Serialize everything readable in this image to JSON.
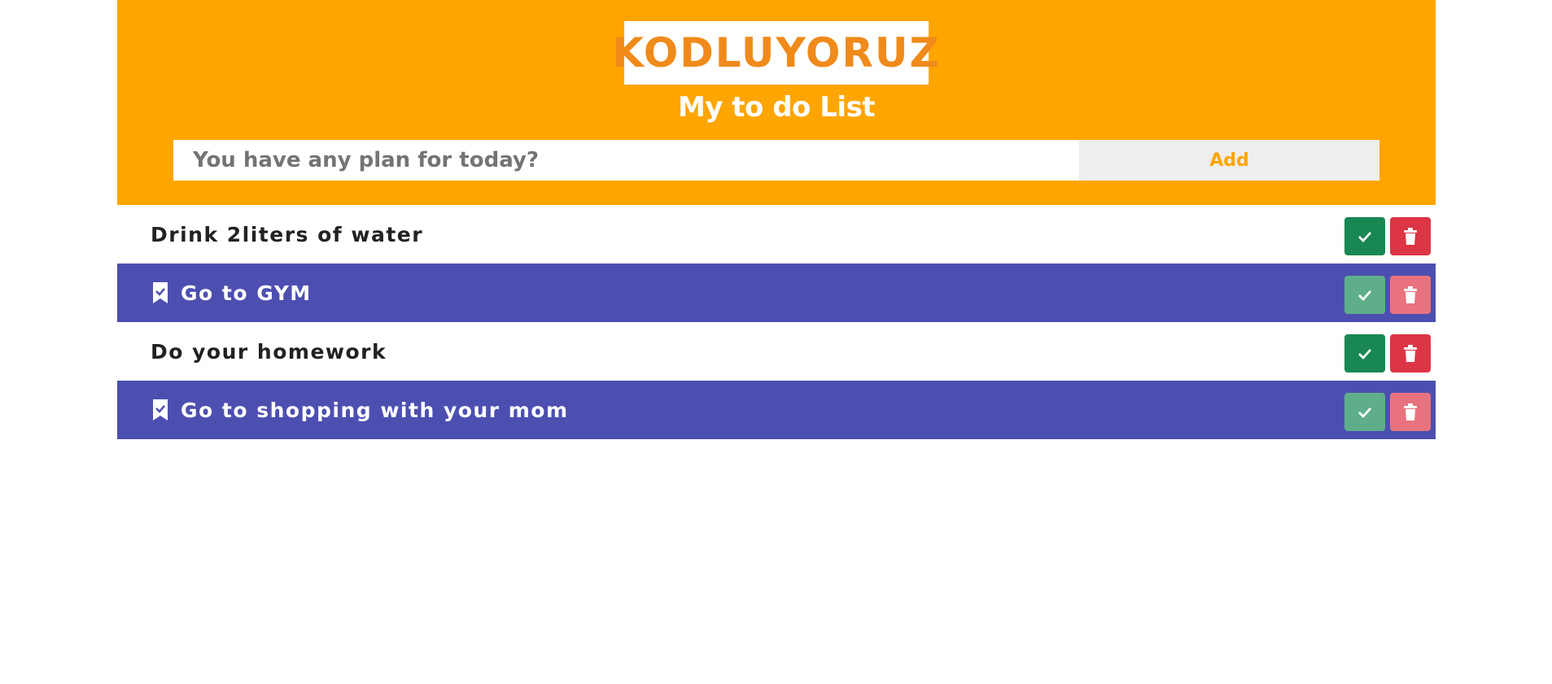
{
  "header": {
    "logo_text": "KODLUYORUZ",
    "title": "My to do List",
    "input_placeholder": "You have any plan for today?",
    "add_label": "Add"
  },
  "colors": {
    "header_bg": "#ffa500",
    "done_row_bg": "#4d4fb0",
    "done_button": "#198754",
    "delete_button": "#dc3545"
  },
  "todos": [
    {
      "text": "Drink 2liters of water",
      "done": false
    },
    {
      "text": "Go to GYM",
      "done": true
    },
    {
      "text": "Do your homework",
      "done": false
    },
    {
      "text": "Go to shopping with your mom",
      "done": true
    }
  ],
  "icons": {
    "item_done": "bookmark-check-icon",
    "done_button": "check-icon",
    "delete_button": "trash-icon"
  }
}
